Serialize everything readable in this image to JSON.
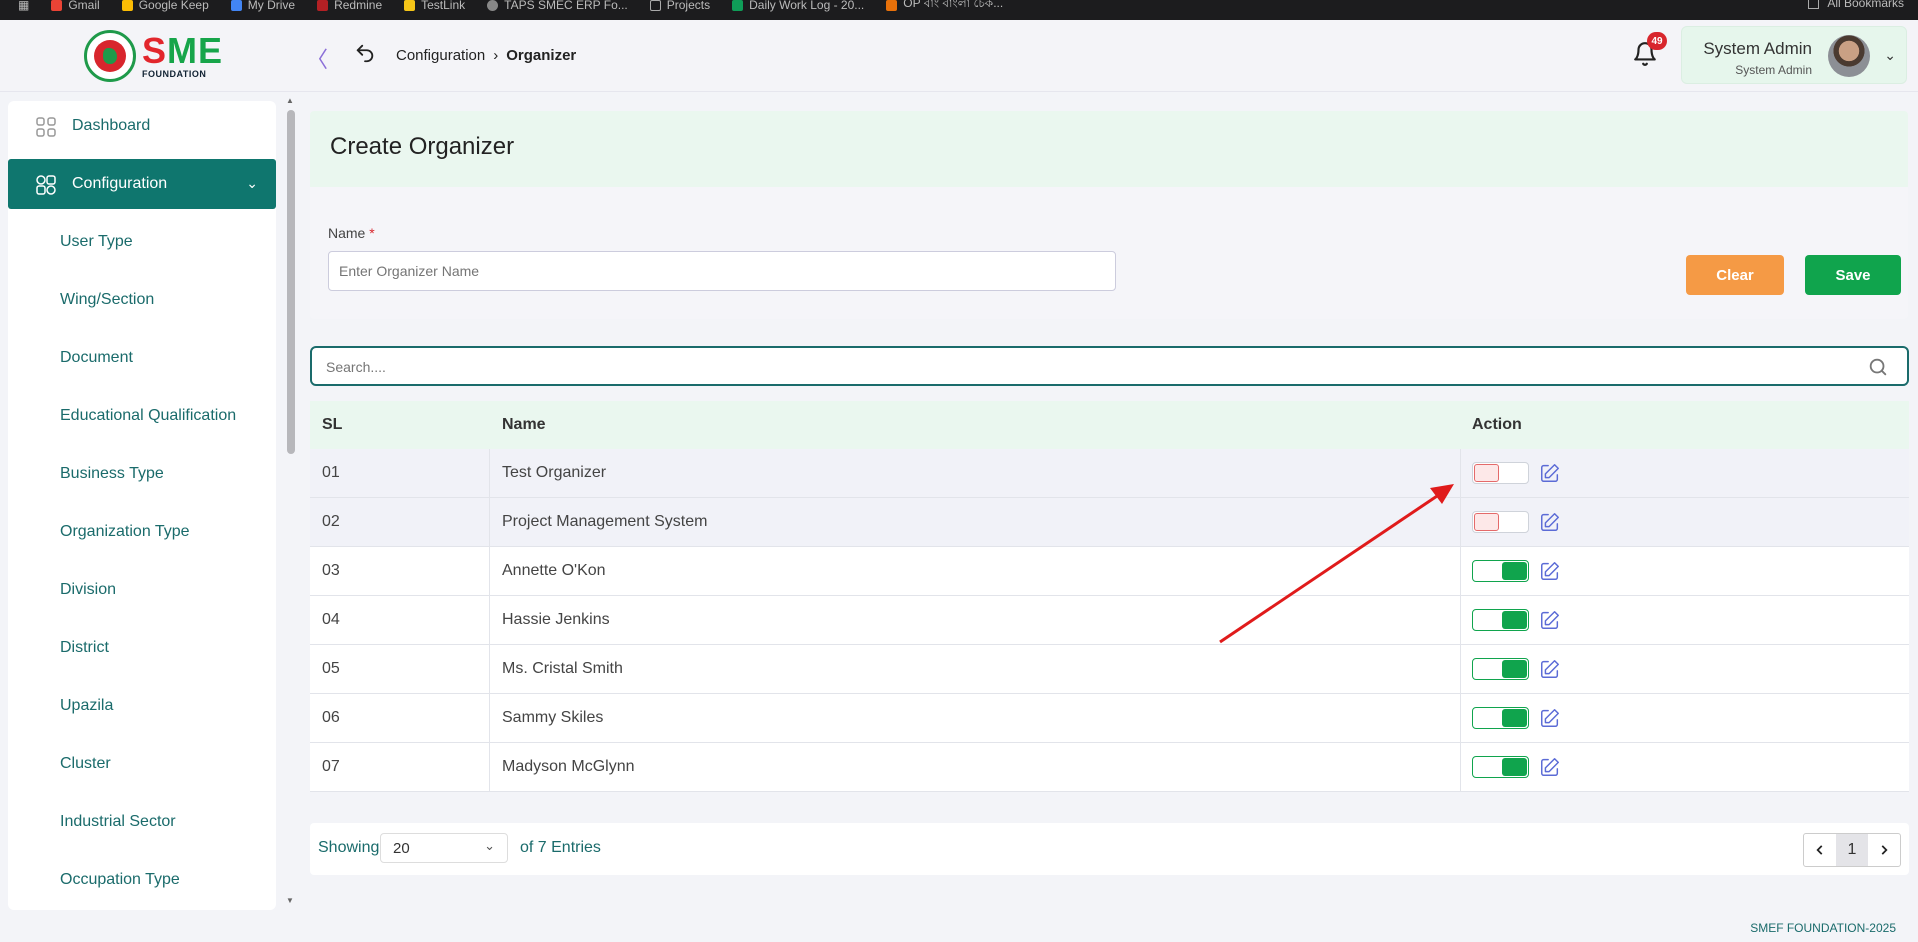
{
  "bookmarks": {
    "items": [
      "Gmail",
      "Google Keep",
      "My Drive",
      "Redmine",
      "TestLink",
      "TAPS SMEC ERP Fo...",
      "Projects",
      "Daily Work Log - 20...",
      "OP বাং বাংলা চেক..."
    ],
    "right": "All Bookmarks"
  },
  "header": {
    "logo_text": "SME",
    "logo_sub": "FOUNDATION",
    "breadcrumb": [
      "Configuration",
      "Organizer"
    ],
    "notification_count": "49",
    "user_name": "System Admin",
    "user_role": "System Admin"
  },
  "sidebar": {
    "items": [
      {
        "label": "Dashboard"
      },
      {
        "label": "Configuration"
      },
      {
        "label": "User Type"
      },
      {
        "label": "Wing/Section"
      },
      {
        "label": "Document"
      },
      {
        "label": "Educational Qualification"
      },
      {
        "label": "Business Type"
      },
      {
        "label": "Organization Type"
      },
      {
        "label": "Division"
      },
      {
        "label": "District"
      },
      {
        "label": "Upazila"
      },
      {
        "label": "Cluster"
      },
      {
        "label": "Industrial Sector"
      },
      {
        "label": "Occupation Type"
      }
    ]
  },
  "form": {
    "title": "Create Organizer",
    "name_label": "Name",
    "required_mark": "*",
    "name_placeholder": "Enter Organizer Name",
    "clear_label": "Clear",
    "save_label": "Save"
  },
  "search": {
    "placeholder": "Search...."
  },
  "table": {
    "headers": [
      "SL",
      "Name",
      "Action"
    ],
    "rows": [
      {
        "sl": "01",
        "name": "Test Organizer",
        "active": false
      },
      {
        "sl": "02",
        "name": "Project Management System",
        "active": false
      },
      {
        "sl": "03",
        "name": "Annette O'Kon",
        "active": true
      },
      {
        "sl": "04",
        "name": "Hassie Jenkins",
        "active": true
      },
      {
        "sl": "05",
        "name": "Ms. Cristal Smith",
        "active": true
      },
      {
        "sl": "06",
        "name": "Sammy Skiles",
        "active": true
      },
      {
        "sl": "07",
        "name": "Madyson McGlynn",
        "active": true
      }
    ]
  },
  "pagination": {
    "showing_label": "Showing",
    "per_page": "20",
    "entries_label": "of 7 Entries",
    "current_page": "1"
  },
  "footer": {
    "copyright": "SMEF FOUNDATION-2025"
  },
  "colors": {
    "primary": "#0f766e",
    "accent_green": "#10a44d",
    "clear_orange": "#f59a45",
    "danger": "#d8262d",
    "annotation_arrow": "#e01b1b"
  }
}
